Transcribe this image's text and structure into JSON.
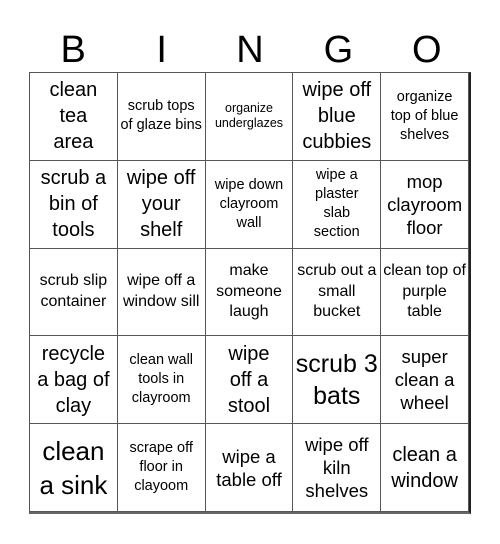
{
  "header": {
    "letters": [
      "B",
      "I",
      "N",
      "G",
      "O"
    ]
  },
  "board": {
    "rows": [
      [
        "clean tea area",
        "scrub tops of glaze bins",
        "organize underglazes",
        "wipe off blue cubbies",
        "organize top of blue shelves"
      ],
      [
        "scrub a bin of tools",
        "wipe off your shelf",
        "wipe down clayroom wall",
        "wipe a plaster slab section",
        "mop clayroom floor"
      ],
      [
        "scrub slip container",
        "wipe off a window sill",
        "make someone laugh",
        "scrub out a small bucket",
        "clean top of purple table"
      ],
      [
        "recycle a bag of clay",
        "clean wall tools in clayroom",
        "wipe off a stool",
        "scrub 3 bats",
        "super clean a wheel"
      ],
      [
        "clean a sink",
        "scrape off floor in clayoom",
        "wipe a table off",
        "wipe off kiln shelves",
        "clean a window"
      ]
    ]
  }
}
